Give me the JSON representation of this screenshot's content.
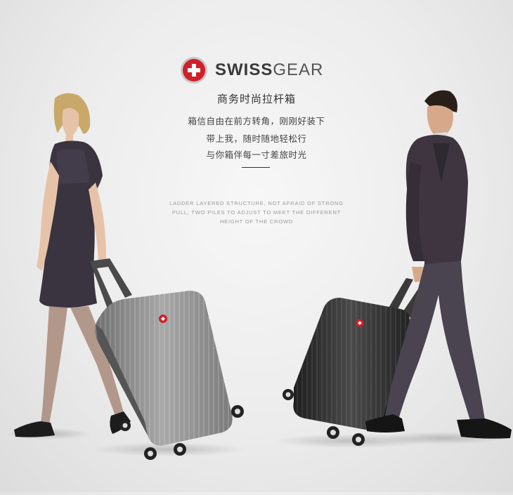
{
  "brand": {
    "name_part1": "SWISS",
    "name_part2": "GEAR",
    "logo_icon": "swiss-cross-shield-icon",
    "logo_color": "#d0202a"
  },
  "headline": "商务时尚拉杆箱",
  "description_lines": [
    "箱信自由在前方转角，刚刚好装下",
    "带上我，随时随地轻松行",
    "与你箱伴每一寸差旅时光"
  ],
  "english_lines": [
    "LADDER LAYERED STRUCTURE, NOT AFRAID OF STRONG",
    "PULL, TWO PILES TO ADJUST TO MEET THE DIFFERENT",
    "HEIGHT OF THE CROWD"
  ],
  "colors": {
    "background": "#ececec",
    "silver_suitcase": "#8a8a8a",
    "black_suitcase": "#2e2e2e"
  }
}
